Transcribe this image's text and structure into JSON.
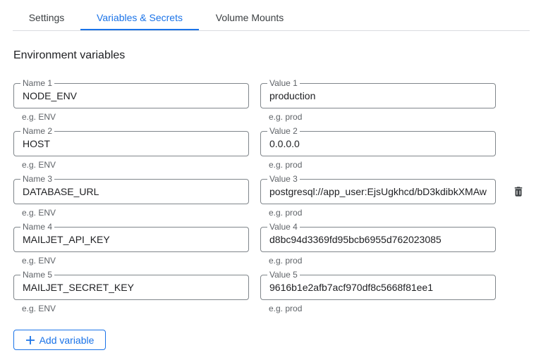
{
  "tabs": [
    {
      "label": "Settings",
      "active": false
    },
    {
      "label": "Variables & Secrets",
      "active": true
    },
    {
      "label": "Volume Mounts",
      "active": false
    }
  ],
  "section_title": "Environment variables",
  "variables": [
    {
      "name_label": "Name 1",
      "name": "NODE_ENV",
      "name_hint": "e.g. ENV",
      "value_label": "Value 1",
      "value": "production",
      "value_hint": "e.g. prod"
    },
    {
      "name_label": "Name 2",
      "name": "HOST",
      "name_hint": "e.g. ENV",
      "value_label": "Value 2",
      "value": "0.0.0.0",
      "value_hint": "e.g. prod"
    },
    {
      "name_label": "Name 3",
      "name": "DATABASE_URL",
      "name_hint": "e.g. ENV",
      "value_label": "Value 3",
      "value": "postgresql://app_user:EjsUgkhcd/bD3kdibkXMAw",
      "value_hint": "e.g. prod"
    },
    {
      "name_label": "Name 4",
      "name": "MAILJET_API_KEY",
      "name_hint": "e.g. ENV",
      "value_label": "Value 4",
      "value": "d8bc94d3369fd95bcb6955d762023085",
      "value_hint": "e.g. prod"
    },
    {
      "name_label": "Name 5",
      "name": "MAILJET_SECRET_KEY",
      "name_hint": "e.g. ENV",
      "value_label": "Value 5",
      "value": "9616b1e2afb7acf970df8c5668f81ee1",
      "value_hint": "e.g. prod"
    }
  ],
  "delete_icon": "trash-icon",
  "add_button_label": "Add variable",
  "colors": {
    "accent": "#1a73e8",
    "border": "#80868b",
    "hint": "#5f6368"
  }
}
